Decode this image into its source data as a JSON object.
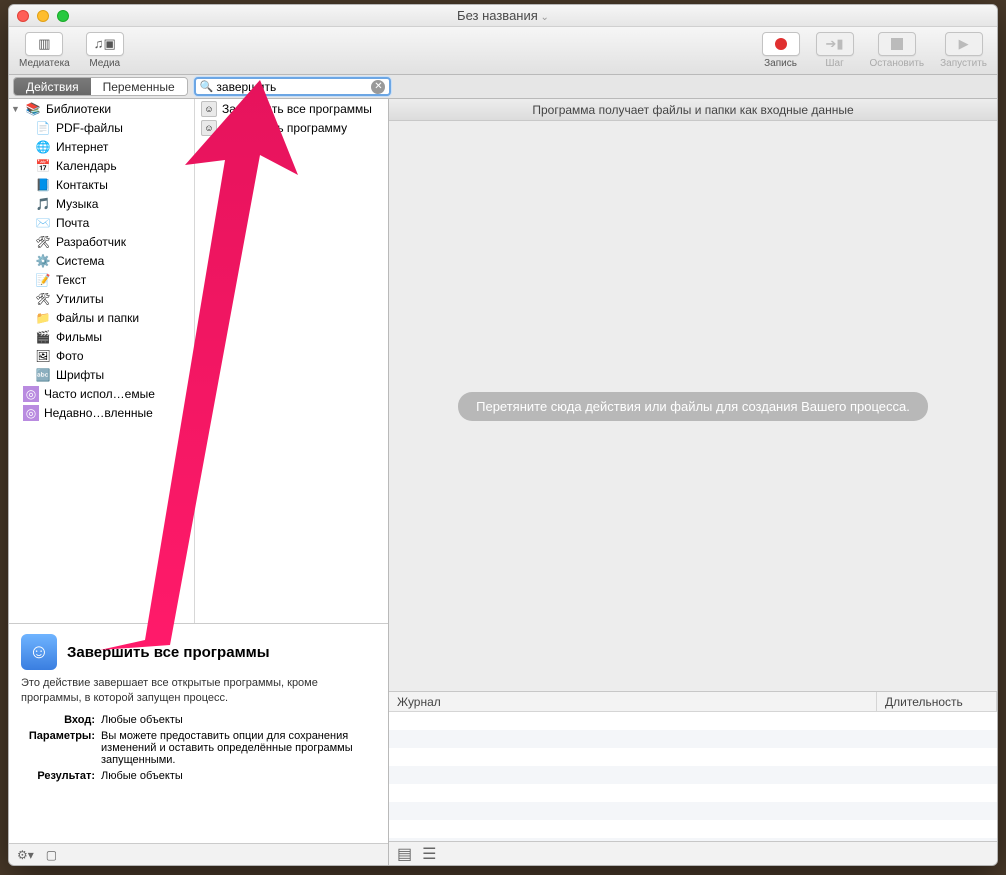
{
  "window": {
    "title": "Без названия"
  },
  "toolbar": {
    "left": [
      {
        "label": "Медиатека",
        "name": "media-library-button"
      },
      {
        "label": "Медиа",
        "name": "media-button"
      }
    ],
    "right": [
      {
        "label": "Запись",
        "name": "record-button"
      },
      {
        "label": "Шаг",
        "name": "step-button"
      },
      {
        "label": "Остановить",
        "name": "stop-button"
      },
      {
        "label": "Запустить",
        "name": "run-button"
      }
    ]
  },
  "tabs": {
    "actions": "Действия",
    "variables": "Переменные"
  },
  "search": {
    "placeholder": "",
    "value": "завершить"
  },
  "library": {
    "header": "Библиотеки",
    "items": [
      {
        "label": "PDF-файлы",
        "icon": "📄"
      },
      {
        "label": "Интернет",
        "icon": "🌐"
      },
      {
        "label": "Календарь",
        "icon": "📅"
      },
      {
        "label": "Контакты",
        "icon": "📘"
      },
      {
        "label": "Музыка",
        "icon": "🎵"
      },
      {
        "label": "Почта",
        "icon": "✉️"
      },
      {
        "label": "Разработчик",
        "icon": "🛠"
      },
      {
        "label": "Система",
        "icon": "⚙️"
      },
      {
        "label": "Текст",
        "icon": "📝"
      },
      {
        "label": "Утилиты",
        "icon": "🛠"
      },
      {
        "label": "Файлы и папки",
        "icon": "📁"
      },
      {
        "label": "Фильмы",
        "icon": "🎬"
      },
      {
        "label": "Фото",
        "icon": "🖼"
      },
      {
        "label": "Шрифты",
        "icon": "🔤"
      }
    ],
    "smart": [
      {
        "label": "Часто испол…емые",
        "color": "#b98be0"
      },
      {
        "label": "Недавно…вленные",
        "color": "#b98be0"
      }
    ]
  },
  "results": [
    {
      "label": "Завершить все программы"
    },
    {
      "label": "Завершить программу"
    }
  ],
  "detail": {
    "title": "Завершить все программы",
    "summary": "Это действие завершает все открытые программы, кроме программы, в которой запущен процесс.",
    "rows": [
      {
        "k": "Вход:",
        "v": "Любые объекты"
      },
      {
        "k": "Параметры:",
        "v": "Вы можете предоставить опции для сохранения изменений и оставить определённые программы запущенными."
      },
      {
        "k": "Результат:",
        "v": "Любые объекты"
      }
    ]
  },
  "flow": {
    "header": "Программа получает файлы и папки как входные данные",
    "placeholder": "Перетяните сюда действия или файлы для создания Вашего процесса."
  },
  "log": {
    "col1": "Журнал",
    "col2": "Длительность"
  }
}
